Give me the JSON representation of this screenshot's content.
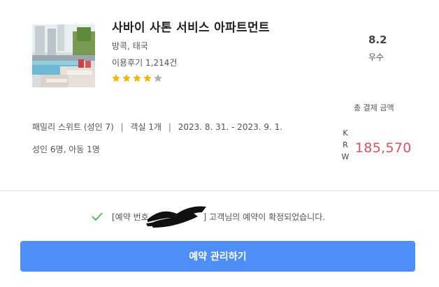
{
  "booking": {
    "hotel_name": "사바이 사톤 서비스 아파트먼트",
    "location": "방콕, 태국",
    "reviews_label": "이용후기",
    "reviews_count": "1,214건",
    "star_rating": 4,
    "star_max": 5,
    "score": "8.2",
    "grade": "우수",
    "room_type": "패밀리 스위트 (성인 7)",
    "rooms": "객실 1개",
    "dates": "2023. 8. 31. - 2023. 9. 1.",
    "separator": "|",
    "guests": "성인 6명, 아동 1명",
    "total_label": "총 결제 금액",
    "currency": [
      "K",
      "R",
      "W"
    ],
    "price": "185,570"
  },
  "confirmation": {
    "prefix": "[예약 번호",
    "suffix": "] 고객님의 예약이 확정되었습니다."
  },
  "actions": {
    "manage_label": "예약 관리하기"
  },
  "colors": {
    "primary_button": "#4d8ef7",
    "price": "#e0505a",
    "star_filled": "#f5b800",
    "star_empty": "#b0b0b0",
    "check": "#5cb85c"
  },
  "icons": {
    "hotel_image": "hotel-pool-photo",
    "check": "check-icon",
    "star": "star-icon"
  }
}
